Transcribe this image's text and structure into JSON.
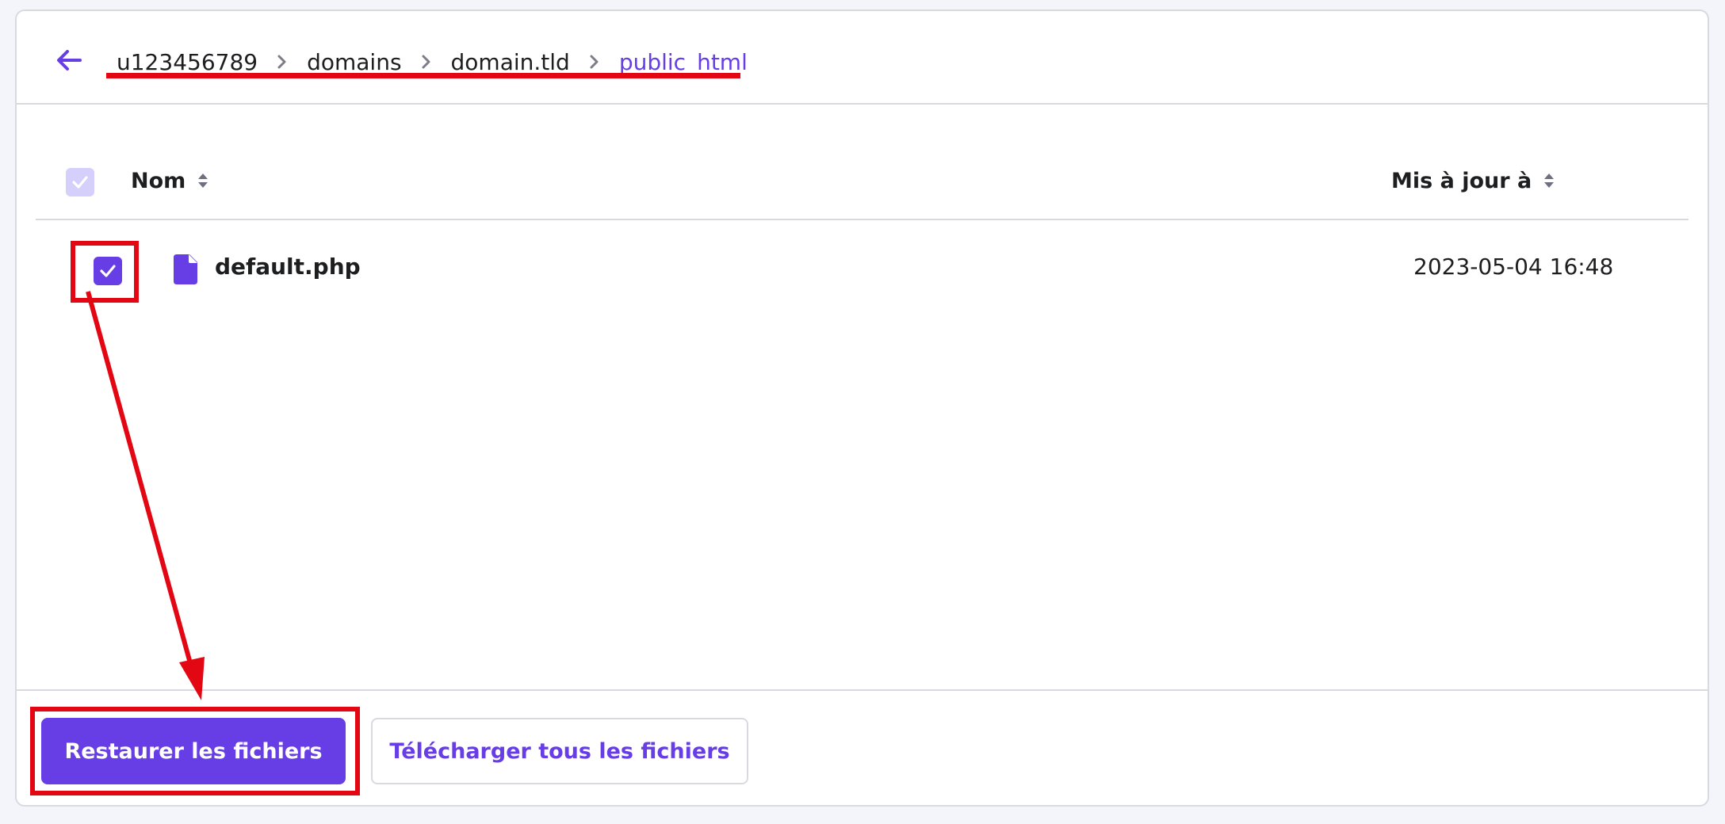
{
  "breadcrumb": {
    "items": [
      {
        "label": "u123456789",
        "active": false
      },
      {
        "label": "domains",
        "active": false
      },
      {
        "label": "domain.tld",
        "active": false
      },
      {
        "label": "public_html",
        "active": true
      }
    ]
  },
  "table": {
    "columns": {
      "name": "Nom",
      "updated": "Mis à jour à"
    },
    "rows": [
      {
        "name": "default.php",
        "updated": "2023-05-04 16:48",
        "selected": true
      }
    ]
  },
  "actions": {
    "restore_label": "Restaurer les fichiers",
    "download_label": "Télécharger tous les fichiers"
  },
  "colors": {
    "accent": "#673de6",
    "annotation": "#e30613",
    "border": "#d8dae0"
  },
  "icons": {
    "back": "arrow-left-icon",
    "separator": "chevron-right-icon",
    "sort": "sort-icon",
    "file": "file-icon",
    "check": "checkmark-icon"
  }
}
